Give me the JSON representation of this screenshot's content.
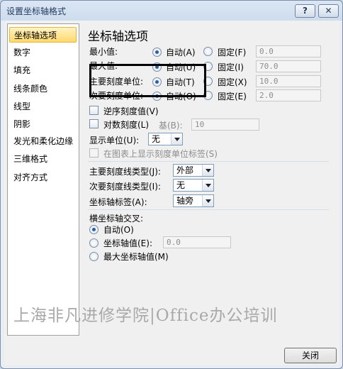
{
  "window": {
    "title": "设置坐标轴格式",
    "help_label": "?",
    "close_label": "✕"
  },
  "sidebar": {
    "items": [
      {
        "label": "坐标轴选项",
        "selected": true
      },
      {
        "label": "数字"
      },
      {
        "label": "填充"
      },
      {
        "label": "线条颜色"
      },
      {
        "label": "线型"
      },
      {
        "label": "阴影"
      },
      {
        "label": "发光和柔化边缘"
      },
      {
        "label": "三维格式"
      },
      {
        "label": "对齐方式"
      }
    ]
  },
  "axis_options": {
    "heading": "坐标轴选项",
    "rows": [
      {
        "label": "最小值:",
        "auto_label": "自动(A)",
        "fixed_label": "固定(F)",
        "value": "0.0",
        "auto_selected": true
      },
      {
        "label": "最大值:",
        "auto_label": "自动(U)",
        "fixed_label": "固定(I)",
        "value": "70.0",
        "auto_selected": true
      },
      {
        "label": "主要刻度单位:",
        "auto_label": "自动(T)",
        "fixed_label": "固定(X)",
        "value": "10.0",
        "auto_selected": true
      },
      {
        "label": "次要刻度单位:",
        "auto_label": "自动(O)",
        "fixed_label": "固定(E)",
        "value": "2.0",
        "auto_selected": true
      }
    ],
    "reverse_order": {
      "label": "逆序刻度值(V)",
      "checked": false
    },
    "log_scale": {
      "label": "对数刻度(L)",
      "base_label": "基(B):",
      "base_value": "10",
      "checked": false
    },
    "display_units": {
      "label": "显示单位(U):",
      "value": "无"
    },
    "show_units_label": {
      "label": "在图表上显示刻度单位标签(S)",
      "checked": false
    },
    "major_tick": {
      "label": "主要刻度线类型(J):",
      "value": "外部"
    },
    "minor_tick": {
      "label": "次要刻度线类型(I):",
      "value": "无"
    },
    "axis_labels": {
      "label": "坐标轴标签(A):",
      "value": "轴旁"
    },
    "crosses": {
      "label": "横坐标轴交叉:",
      "auto_label": "自动(O)",
      "value_label": "坐标轴值(E):",
      "value": "0.0",
      "max_label": "最大坐标轴值(M)",
      "selected": "auto"
    }
  },
  "watermark": "上海非凡进修学院|Office办公培训",
  "footer": {
    "close_button": "关闭"
  }
}
